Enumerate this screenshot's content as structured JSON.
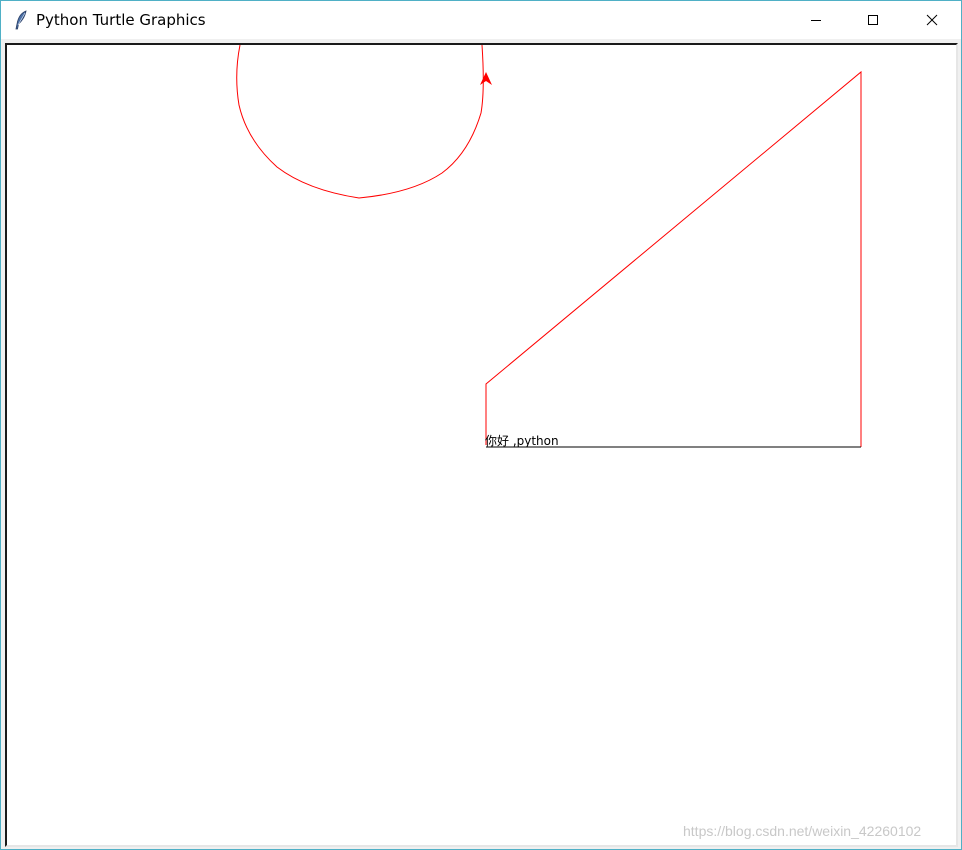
{
  "window": {
    "title": "Python Turtle Graphics"
  },
  "canvas": {
    "text": "你好 ,python",
    "pen_color": "#ff0000",
    "outline_color": "#000000"
  },
  "watermark": "https://blog.csdn.net/weixin_42260102"
}
